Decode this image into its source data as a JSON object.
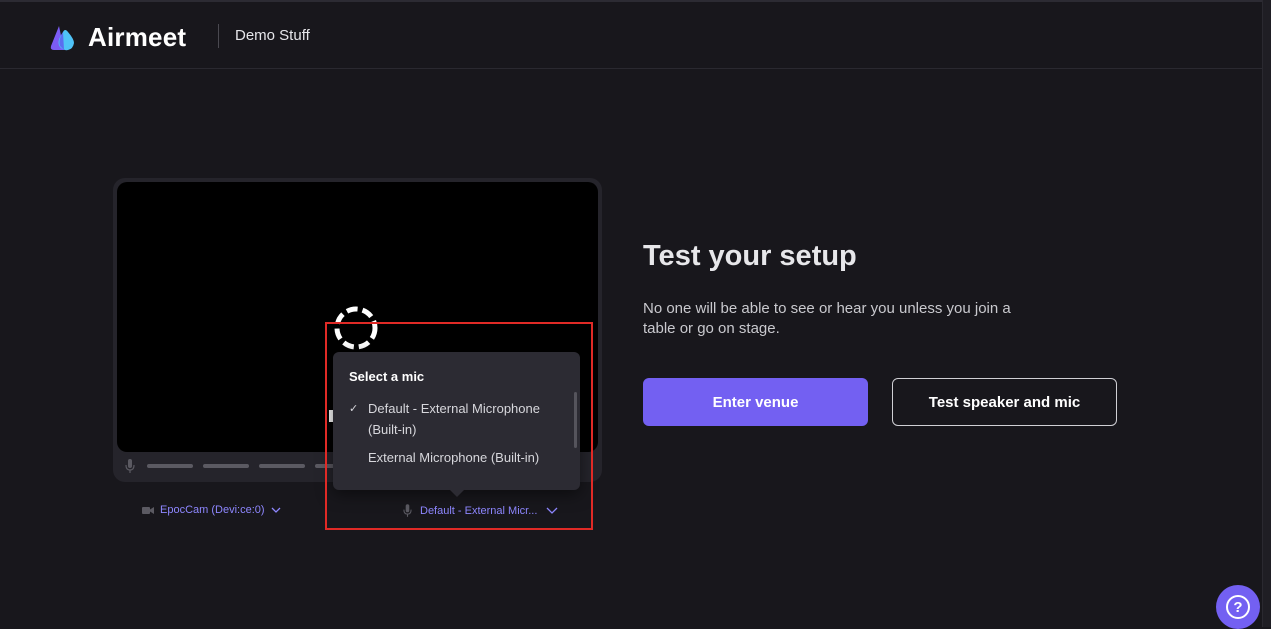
{
  "header": {
    "brand": "Airmeet",
    "event_name": "Demo Stuff"
  },
  "preview": {
    "camera_label": "EpocCam (Devi:ce:0)",
    "mic_label": "Default - External Micr..."
  },
  "mic_dropdown": {
    "title": "Select a mic",
    "options": [
      {
        "label": "Default - External Microphone (Built-in)",
        "selected": true
      },
      {
        "label": "External Microphone (Built-in)",
        "selected": false
      }
    ]
  },
  "setup": {
    "title": "Test your setup",
    "subtitle": "No one will be able to see or hear you unless you join a table or go on stage.",
    "enter_label": "Enter venue",
    "test_label": "Test speaker and mic"
  },
  "help": {
    "label": "?"
  },
  "colors": {
    "accent": "#7360f2",
    "link": "#8e87ff",
    "highlight": "#e02a26",
    "background": "#18171c"
  },
  "icons": [
    "airmeet-logo-icon",
    "camera-icon",
    "mic-icon",
    "chevron-down-icon",
    "check-icon",
    "loading-spinner-icon",
    "help-icon"
  ]
}
